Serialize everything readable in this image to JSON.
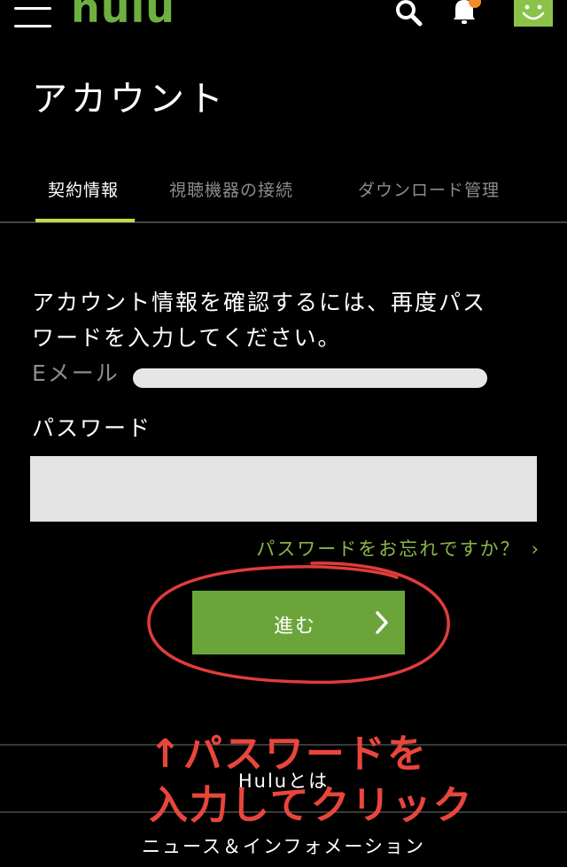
{
  "header": {
    "logo": "hulu",
    "menu_icon": "hamburger-menu-icon",
    "search_icon": "search-icon",
    "bell_icon": "bell-icon",
    "avatar_icon": "smiley-avatar-icon",
    "notification_color": "#f28c28",
    "brand_color": "#6db03f"
  },
  "page": {
    "title": "アカウント"
  },
  "tabs": [
    {
      "label": "契約情報",
      "active": true
    },
    {
      "label": "視聴機器の接続",
      "active": false
    },
    {
      "label": "ダウンロード管理",
      "active": false
    }
  ],
  "form": {
    "instruction_line1": "アカウント情報を確認するには、再度パス",
    "instruction_line2": "ワードを入力してください。",
    "email_label": "Eメール",
    "password_label": "パスワード",
    "password_value": "",
    "forgot_link": "パスワードをお忘れですか？",
    "submit_label": "進む",
    "button_color": "#6ba53a"
  },
  "footer": {
    "links": [
      "Huluとは",
      "ニュース＆インフォメーション"
    ]
  },
  "annotation": {
    "line1": "↑パスワードを",
    "line2": "入力してクリック",
    "color": "#e8463c"
  }
}
